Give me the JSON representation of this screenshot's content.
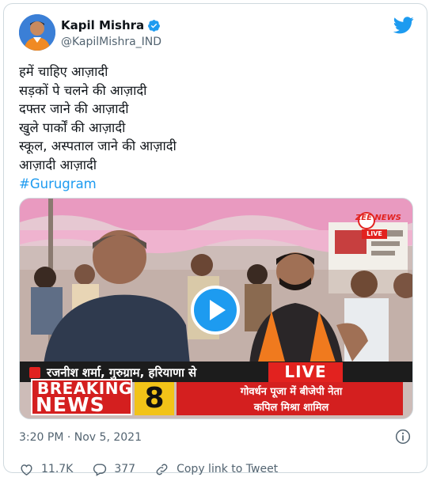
{
  "author": {
    "name": "Kapil Mishra",
    "handle": "@KapilMishra_IND",
    "verified": true
  },
  "tweet": {
    "lines": [
      "हमें चाहिए आज़ादी",
      "सड़कों पे चलने की आज़ादी",
      "दफ्तर जाने की आज़ादी",
      "खुले पार्कों की आज़ादी",
      "स्कूल, अस्पताल जाने की आज़ादी",
      "आज़ादी आज़ादी"
    ],
    "hashtag": "#Gurugram"
  },
  "media": {
    "channel_logo": "ZEE NEWS",
    "logo_live": "LIVE",
    "reporter_caption": "रजनीश शर्मा, गुरुग्राम, हरियाणा से",
    "live_label": "LIVE",
    "breaking": "BREAKING",
    "news": "NEWS",
    "channel_number": "8",
    "headline_line1": "गोवर्धन पूजा में बीजेपी नेता",
    "headline_line2": "कपिल मिश्रा शामिल"
  },
  "meta": {
    "timestamp": "3:20 PM · Nov 5, 2021"
  },
  "actions": {
    "likes": "11.7K",
    "replies": "377",
    "copy_link": "Copy link to Tweet"
  },
  "colors": {
    "twitter_blue": "#1d9bf0",
    "text": "#0f1419",
    "muted": "#536471",
    "breaking_red": "#d41f1f",
    "channel_yellow": "#f2c318"
  }
}
